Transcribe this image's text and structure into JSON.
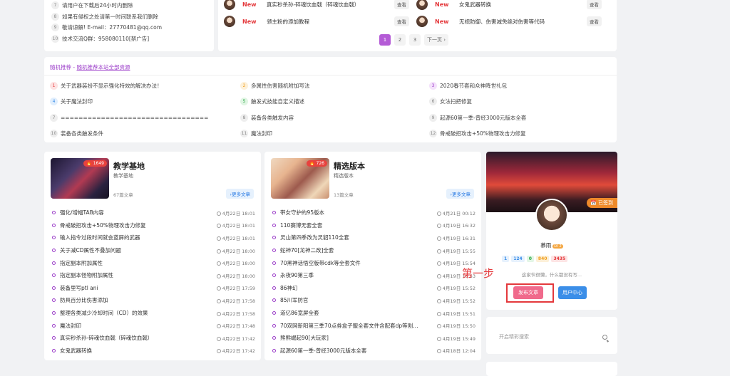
{
  "notice": {
    "items": [
      {
        "num": "7",
        "text": "请用户在下载后24小时内删除"
      },
      {
        "num": "8",
        "text": "如果有侵权之处请第一时间联系我们删除"
      },
      {
        "num": "9",
        "text": "敬请谅解! E-mail：27770481@qq.com"
      },
      {
        "num": "10",
        "text": "技术交流Q群：958080110[禁广告]"
      }
    ]
  },
  "newposts": {
    "items": [
      {
        "new": "New",
        "title": "真实秒杀孙-碎魂饮血戟（碎魂饮血戟）",
        "view": "查看"
      },
      {
        "new": "New",
        "title": "女鬼武器转换",
        "view": "查看"
      },
      {
        "new": "New",
        "title": "领主粉的添加教程",
        "view": "查看"
      },
      {
        "new": "New",
        "title": "无视防御、伤害减免绝对伤害等代码",
        "view": "查看"
      }
    ],
    "pager": [
      "1",
      "2",
      "3",
      "下一页 ›"
    ]
  },
  "recommend": {
    "heading": "随机推荐 - ",
    "heading_link": "随机推荐本站全部资源",
    "items": [
      {
        "num": "1",
        "text": "关于武器装扮不显示强化特效的解决办法！"
      },
      {
        "num": "2",
        "text": "多属性伤害随机附加写法"
      },
      {
        "num": "3",
        "text": "2020春节套和众神降世礼包"
      },
      {
        "num": "4",
        "text": "关于魔法封印"
      },
      {
        "num": "5",
        "text": "触发式技能自定义描述"
      },
      {
        "num": "6",
        "text": "女法扫把修复"
      },
      {
        "num": "7",
        "text": "================================="
      },
      {
        "num": "8",
        "text": "装备各类触发内容"
      },
      {
        "num": "9",
        "text": "起源60第一季-曾经3000元版本全套"
      },
      {
        "num": "10",
        "text": "装备各类触发条件"
      },
      {
        "num": "11",
        "text": "魔法封印"
      },
      {
        "num": "12",
        "text": "骨戒破招攻击+50%物理攻击力修复"
      }
    ]
  },
  "categories": [
    {
      "title": "教学基地",
      "sub": "教学基地",
      "badge": "🔥 1649",
      "count": "67篇文章",
      "more": "›更多文章",
      "rows": [
        {
          "title": "强化/增幅TAB内容",
          "date": "4月22日 18:01"
        },
        {
          "title": "骨戒破招攻击+50%物理攻击力修复",
          "date": "4月22日 18:01"
        },
        {
          "title": "输入指令过段时间就会蓝屏的武器",
          "date": "4月22日 18:01"
        },
        {
          "title": "关于减CD属性不叠加问题",
          "date": "4月22日 18:00"
        },
        {
          "title": "指定副本附加属性",
          "date": "4月22日 18:00"
        },
        {
          "title": "指定副本怪物附加属性",
          "date": "4月22日 18:00"
        },
        {
          "title": "装备里写ptl ani",
          "date": "4月22日 17:59"
        },
        {
          "title": "防具百分比伤害添加",
          "date": "4月22日 17:58"
        },
        {
          "title": "整理各类减少冷却时间（CD）的效果",
          "date": "4月22日 17:58"
        },
        {
          "title": "魔法封印",
          "date": "4月22日 17:48"
        },
        {
          "title": "真实秒杀孙-碎魂饮血戟（碎魂饮血戟）",
          "date": "4月22日 17:42"
        },
        {
          "title": "女鬼武器转换",
          "date": "4月22日 17:42"
        }
      ]
    },
    {
      "title": "精选版本",
      "sub": "精选版本",
      "badge": "🔥 726",
      "count": "13篇文章",
      "more": "›更多文章",
      "rows": [
        {
          "title": "带女守护的95版本",
          "date": "4月21日 00:12"
        },
        {
          "title": "110赛博无套全套",
          "date": "4月19日 16:32"
        },
        {
          "title": "灵山第四季改为灵貂110全套",
          "date": "4月19日 16:31"
        },
        {
          "title": "蛇神70[龙神二改]全套",
          "date": "4月19日 15:55"
        },
        {
          "title": "70黑神话悟空版带cdk等全套文件",
          "date": "4月19日 15:54"
        },
        {
          "title": "永夜90第三季",
          "date": "4月19日 15:53"
        },
        {
          "title": "86神幻",
          "date": "4月19日 15:52"
        },
        {
          "title": "85川军防官",
          "date": "4月19日 15:52"
        },
        {
          "title": "道亿86宽屏全套",
          "date": "4月19日 15:51"
        },
        {
          "title": "70双网新阳第三季70点券盒子服全套文件含配套dp等割…",
          "date": "4月19日 15:50"
        },
        {
          "title": "熊熊崛起90[大玩家]",
          "date": "4月19日 15:49"
        },
        {
          "title": "起源60第一季-曾经3000元版本全套",
          "date": "4月18日 12:04"
        }
      ]
    }
  ],
  "profile": {
    "signed": "已签到",
    "name": "慕雨",
    "level": "LV 2",
    "stats": [
      {
        "label": "1",
        "color": "#3b8ee8",
        "bg": "#e6f1fd"
      },
      {
        "label": "124",
        "color": "#3b8ee8",
        "bg": "#e6f1fd"
      },
      {
        "label": "0",
        "color": "#29a745",
        "bg": "#e3f6e6"
      },
      {
        "label": "840",
        "color": "#f0a020",
        "bg": "#fdf0d8"
      },
      {
        "label": "3435",
        "color": "#e4393c",
        "bg": "#fde4e4"
      }
    ],
    "desc": "这家伙很懒，什么都没有写...",
    "post_button": "发布文章",
    "center_button": "用户中心"
  },
  "annotation": {
    "step": "第一步"
  },
  "search": {
    "placeholder": "开启精彩搜索"
  }
}
